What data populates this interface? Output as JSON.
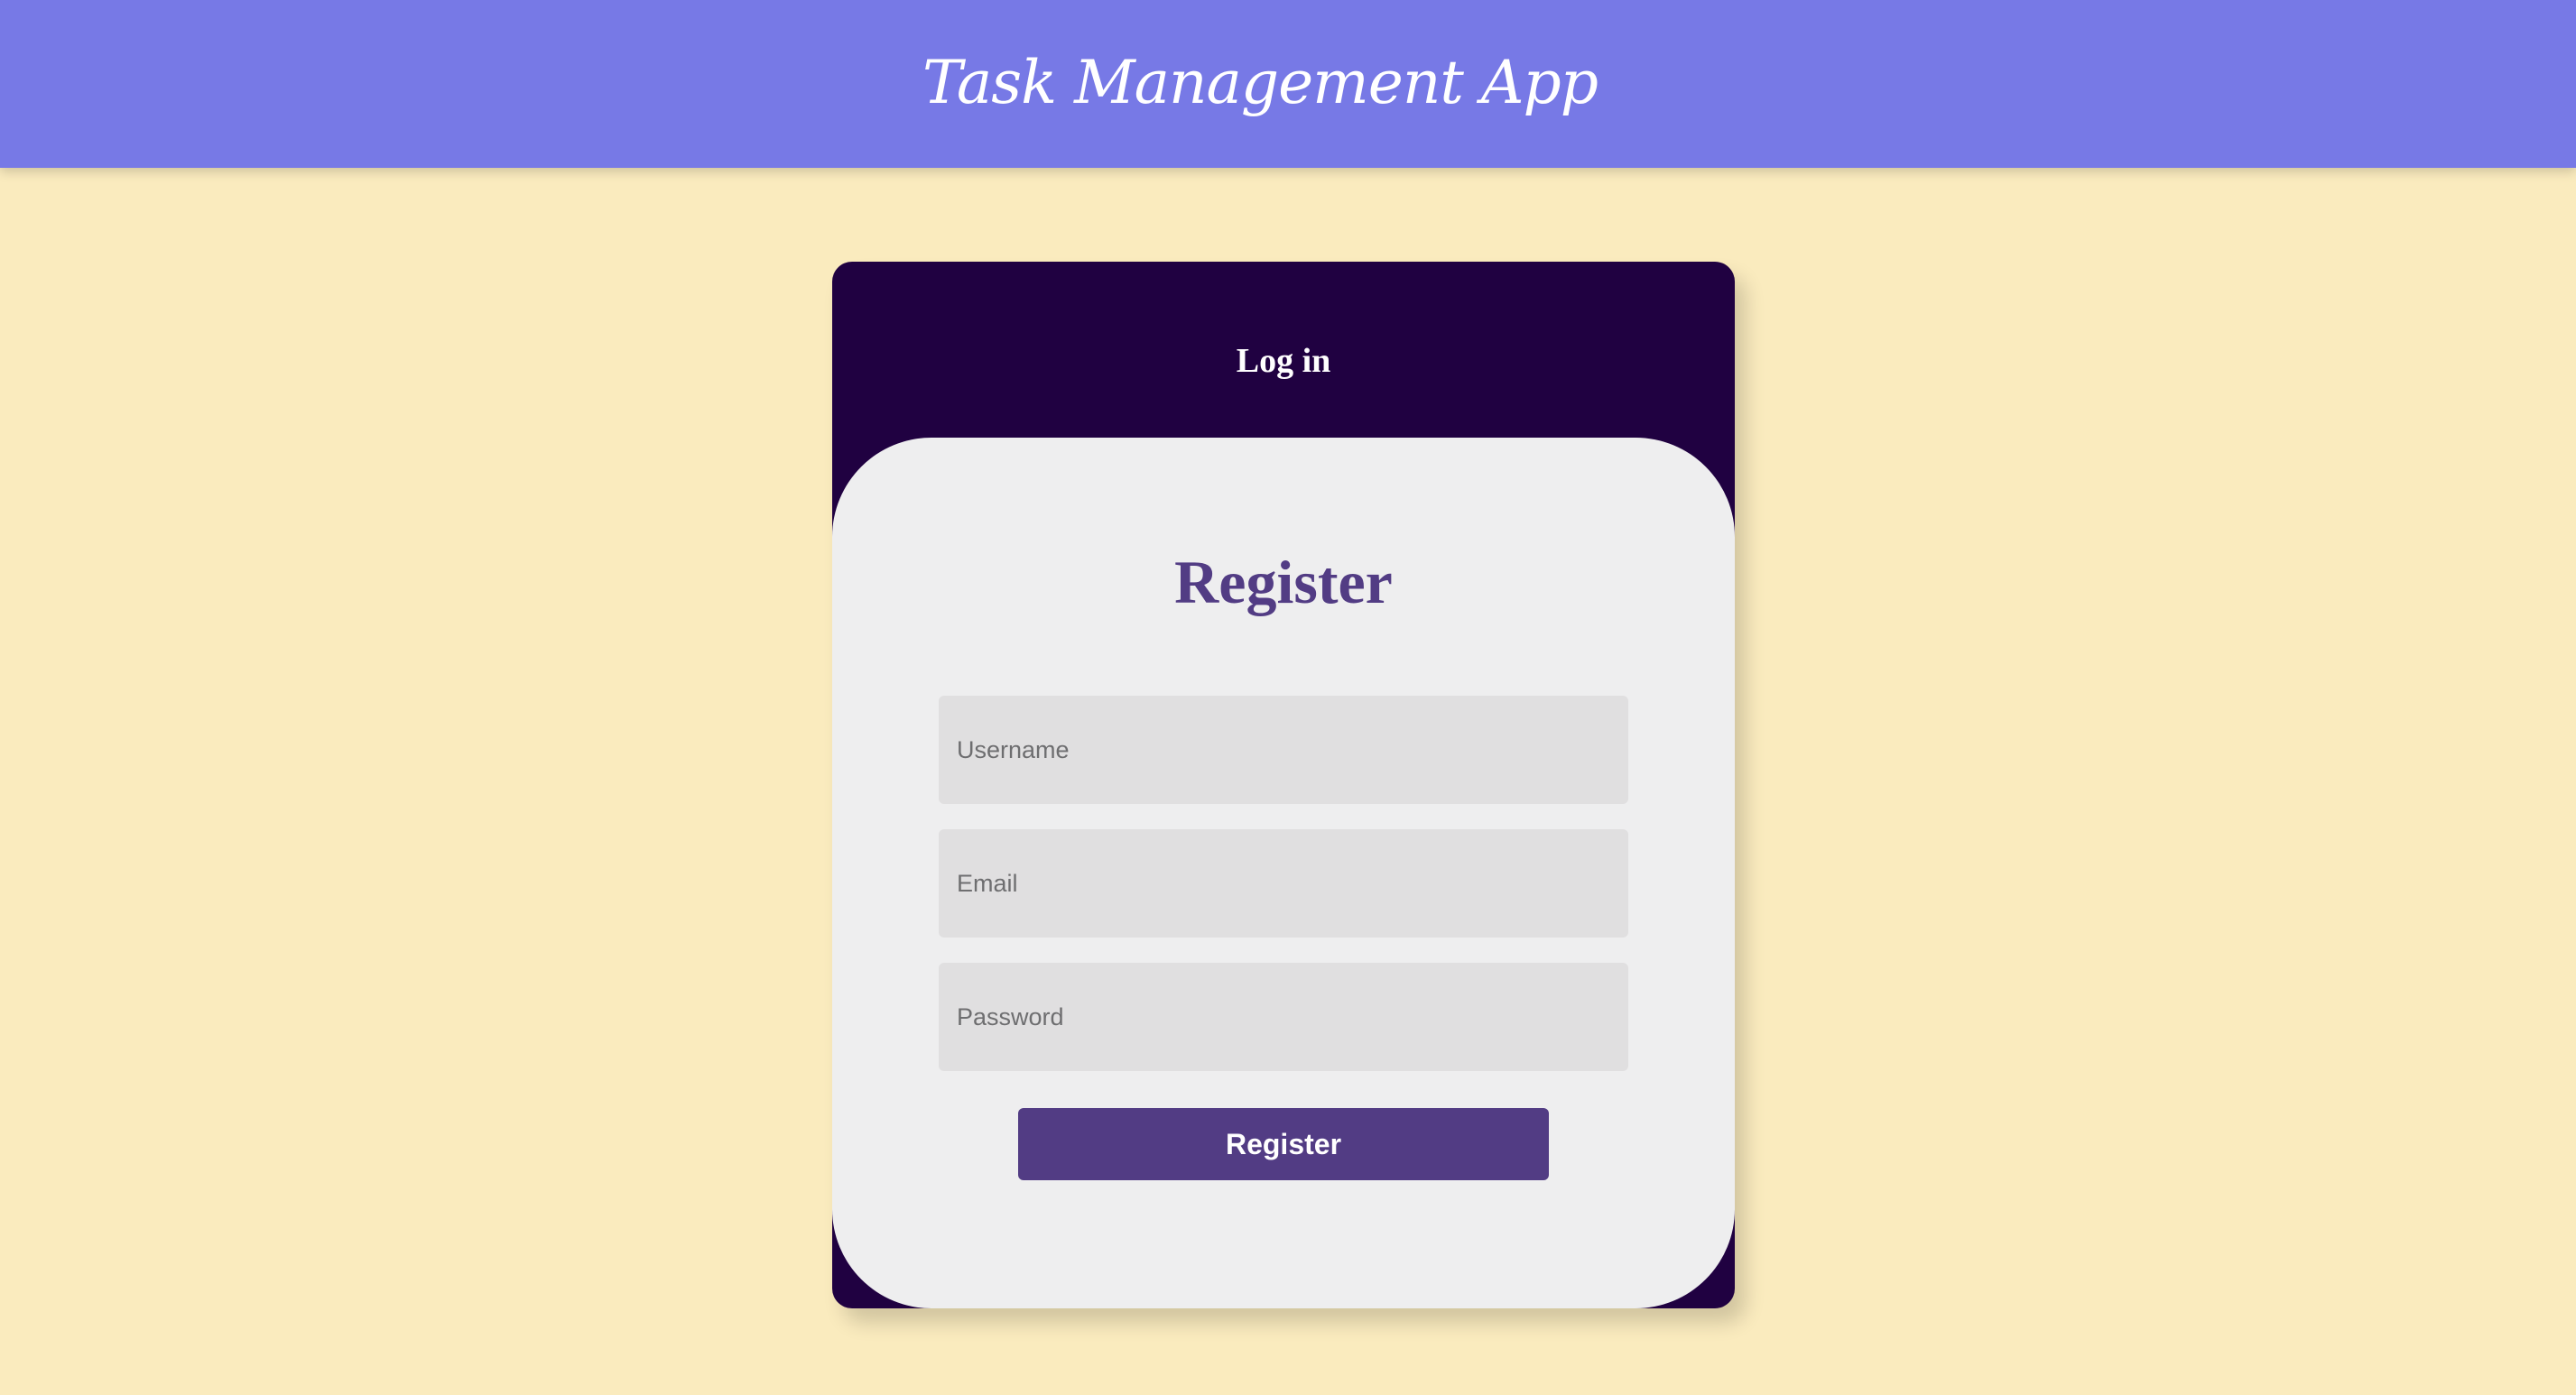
{
  "header": {
    "title": "Task Management App",
    "background_color": "#7779E6"
  },
  "page": {
    "background_color": "#FAEBBE"
  },
  "auth_card": {
    "background_color": "#200141",
    "login_tab_label": "Log in",
    "register_panel": {
      "heading": "Register",
      "heading_color": "#523C84",
      "username_placeholder": "Username",
      "username_value": "",
      "email_placeholder": "Email",
      "email_value": "",
      "password_placeholder": "Password",
      "password_value": "",
      "submit_label": "Register",
      "submit_color": "#523C84"
    }
  }
}
